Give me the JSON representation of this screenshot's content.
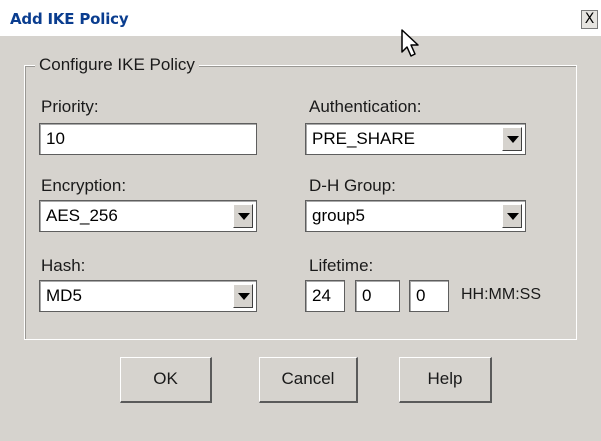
{
  "window": {
    "title": "Add IKE Policy",
    "close_label": "X"
  },
  "group": {
    "legend": "Configure IKE Policy"
  },
  "priority": {
    "label": "Priority:",
    "value": "10"
  },
  "authentication": {
    "label": "Authentication:",
    "value": "PRE_SHARE"
  },
  "encryption": {
    "label": "Encryption:",
    "value": "AES_256"
  },
  "dh_group": {
    "label": "D-H Group:",
    "value": "group5"
  },
  "hash": {
    "label": "Hash:",
    "value": "MD5"
  },
  "lifetime": {
    "label": "Lifetime:",
    "hours": "24",
    "minutes": "0",
    "seconds": "0",
    "format_label": "HH:MM:SS"
  },
  "buttons": {
    "ok": "OK",
    "cancel": "Cancel",
    "help": "Help"
  },
  "icons": {
    "cursor": "mouse-pointer-icon",
    "close": "close-icon",
    "dropdown": "chevron-down-icon"
  }
}
